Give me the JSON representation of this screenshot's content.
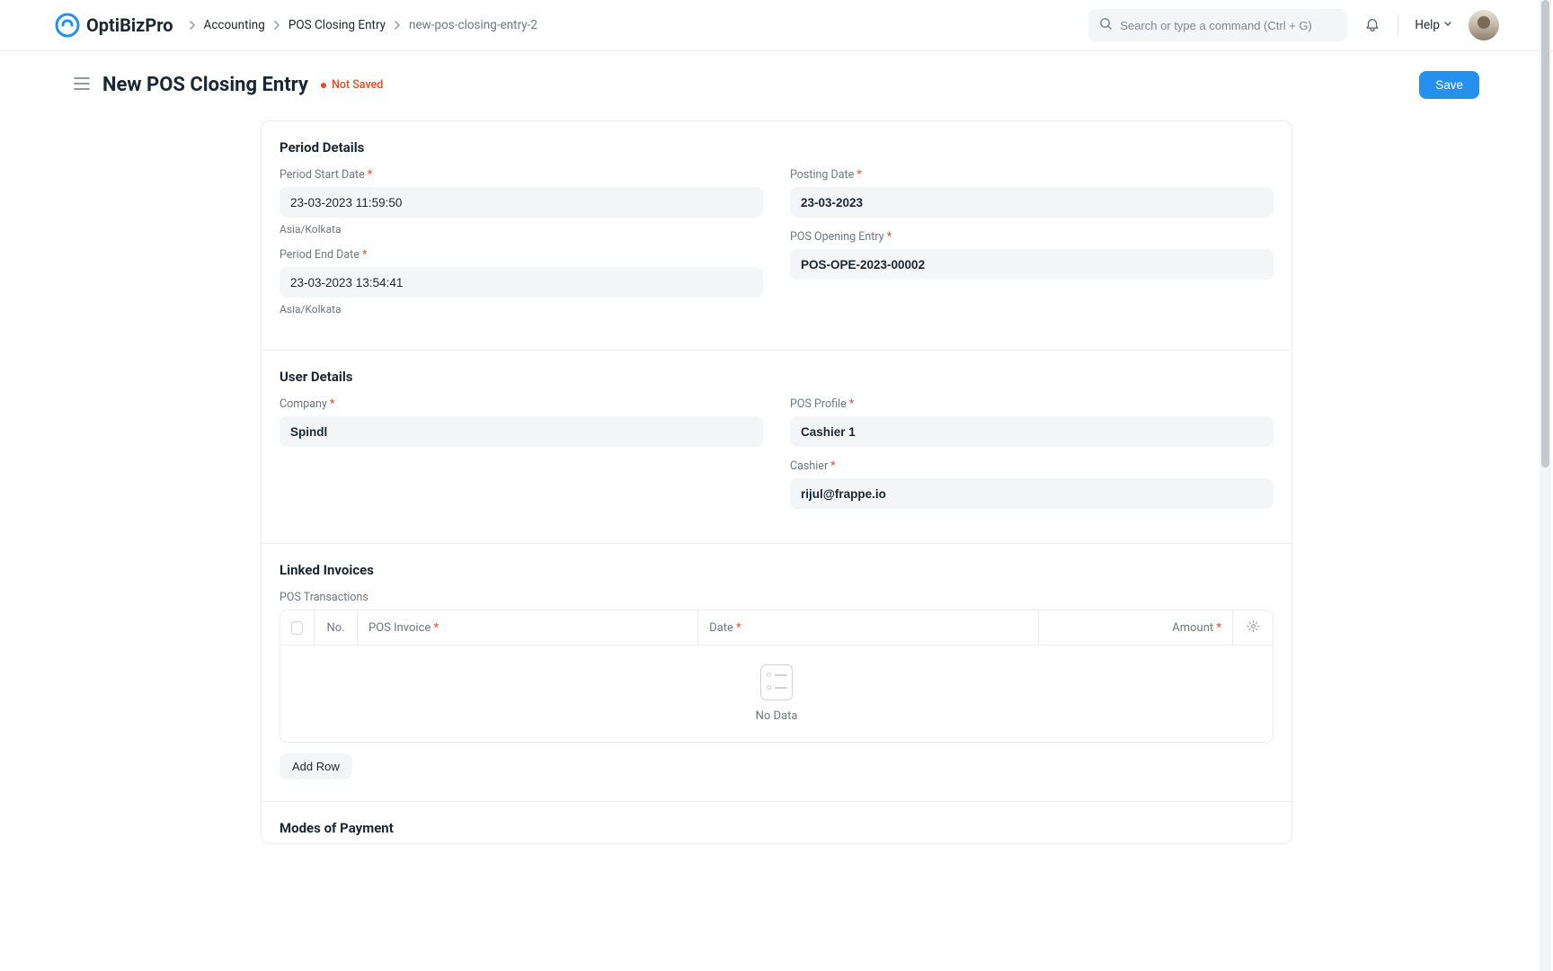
{
  "brand": "OptiBizPro",
  "breadcrumb": [
    "Accounting",
    "POS Closing Entry",
    "new-pos-closing-entry-2"
  ],
  "search": {
    "placeholder": "Search or type a command (Ctrl + G)"
  },
  "nav": {
    "help": "Help"
  },
  "page": {
    "title": "New POS Closing Entry",
    "status": "Not Saved",
    "save": "Save"
  },
  "sections": {
    "period": {
      "title": "Period Details",
      "start_label": "Period Start Date",
      "start_value": "23-03-2023 11:59:50",
      "start_tz": "Asia/Kolkata",
      "end_label": "Period End Date",
      "end_value": "23-03-2023 13:54:41",
      "end_tz": "Asia/Kolkata",
      "posting_label": "Posting Date",
      "posting_value": "23-03-2023",
      "opening_label": "POS Opening Entry",
      "opening_value": "POS-OPE-2023-00002"
    },
    "user": {
      "title": "User Details",
      "company_label": "Company",
      "company_value": "Spindl",
      "profile_label": "POS Profile",
      "profile_value": "Cashier 1",
      "cashier_label": "Cashier",
      "cashier_value": "rijul@frappe.io"
    },
    "linked": {
      "title": "Linked Invoices",
      "table_label": "POS Transactions",
      "cols": {
        "no": "No.",
        "invoice": "POS Invoice",
        "date": "Date",
        "amount": "Amount"
      },
      "empty": "No Data",
      "add_row": "Add Row"
    },
    "mop": {
      "title": "Modes of Payment"
    }
  }
}
